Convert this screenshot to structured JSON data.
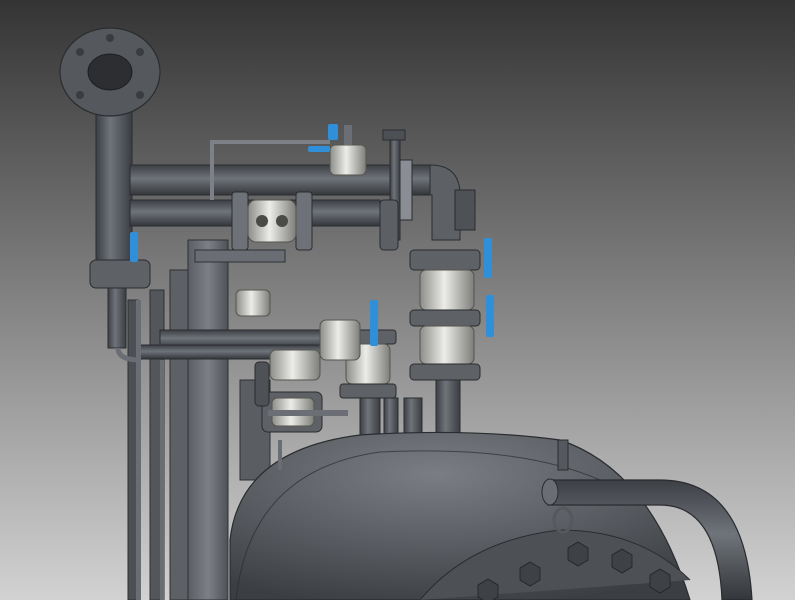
{
  "scene": {
    "background_top": "#343434",
    "background_bottom": "#cfcfcf",
    "metal_dark": "#4a4d52",
    "metal_mid": "#6b6f75",
    "metal_light": "#9aa0a6",
    "steel_highlight": "#e6e6e2",
    "valve_handle_color": "#2f8fd8"
  }
}
